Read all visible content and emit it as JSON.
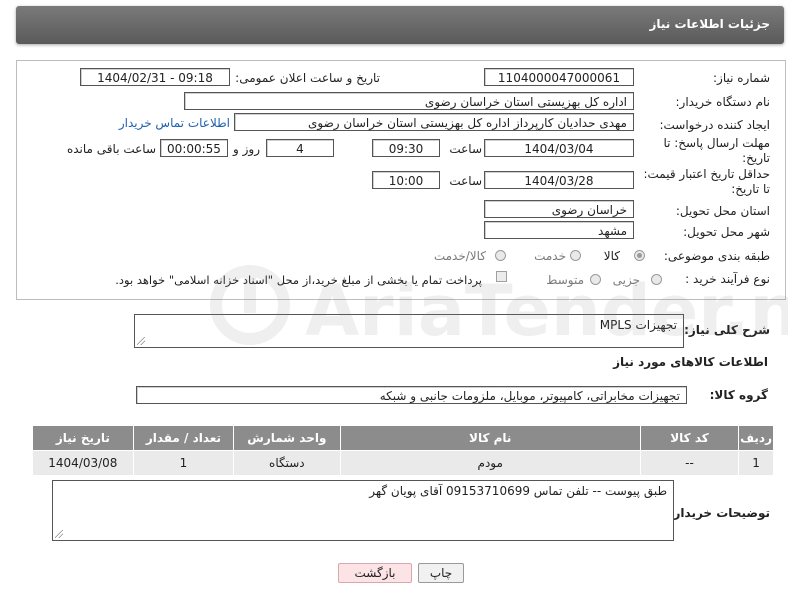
{
  "header": {
    "title": "جزئیات اطلاعات نیاز"
  },
  "form": {
    "need_number_label": "شماره نیاز:",
    "need_number": "1104000047000061",
    "announce_label": "تاریخ و ساعت اعلان عمومی:",
    "announce_value": "1404/02/31 - 09:18",
    "buyer_org_label": "نام دستگاه خریدار:",
    "buyer_org": "اداره کل بهزیستی استان خراسان رضوی",
    "creator_label": "ایجاد کننده درخواست:",
    "creator": "مهدی حدادیان کارپرداز اداره کل بهزیستی استان خراسان رضوی",
    "contact_link": "اطلاعات تماس خریدار",
    "deadline_label_1": "مهلت ارسال پاسخ: تا",
    "deadline_label_2": "تاریخ:",
    "deadline_date": "1404/03/04",
    "time_label": "ساعت",
    "deadline_time": "09:30",
    "days_value": "4",
    "days_label": "روز و",
    "remaining_value": "00:00:55",
    "remaining_label": "ساعت باقی مانده",
    "validity_label_1": "حداقل تاریخ اعتبار قیمت:",
    "validity_label_2": "تا تاریخ:",
    "validity_date": "1404/03/28",
    "validity_time_label": "ساعت",
    "validity_time": "10:00",
    "province_label": "استان محل تحویل:",
    "province": "خراسان رضوی",
    "city_label": "شهر محل تحویل:",
    "city": "مشهد",
    "category_label": "طبقه بندی موضوعی:",
    "category_options": [
      "کالا",
      "خدمت",
      "کالا/خدمت"
    ],
    "category_selected": "کالا",
    "process_label": "نوع فرآیند خرید :",
    "process_options": [
      "جزیی",
      "متوسط"
    ],
    "payment_note": "پرداخت تمام یا بخشی از مبلغ خرید،از محل \"اسناد خزانه اسلامی\" خواهد بود."
  },
  "description": {
    "label": "شرح کلی نیاز:",
    "value": "تجهیزات  MPLS"
  },
  "goods_section": {
    "title": "اطلاعات کالاهای مورد نیاز",
    "group_label": "گروه کالا:",
    "group_value": "تجهیزات مخابراتی، کامپیوتر، موبایل، ملزومات جانبی و شبکه"
  },
  "table": {
    "headers": [
      "ردیف",
      "کد کالا",
      "نام کالا",
      "واحد شمارش",
      "تعداد / مقدار",
      "تاریخ نیاز"
    ],
    "rows": [
      [
        "1",
        "--",
        "مودم",
        "دستگاه",
        "1",
        "1404/03/08"
      ]
    ]
  },
  "buyer_notes": {
    "label": "توضیحات خریدار:",
    "value": "طبق پیوست -- تلفن تماس 09153710699 آقای پویان گهر"
  },
  "buttons": {
    "print": "چاپ",
    "back": "بازگشت"
  },
  "watermark": {
    "text": "AriaTender.neT"
  },
  "colors": {
    "header_bg": "#6b6b6b",
    "table_header_bg": "#8c8c8c",
    "link": "#1f5fb0",
    "back_button_bg": "#fbe3e6"
  }
}
